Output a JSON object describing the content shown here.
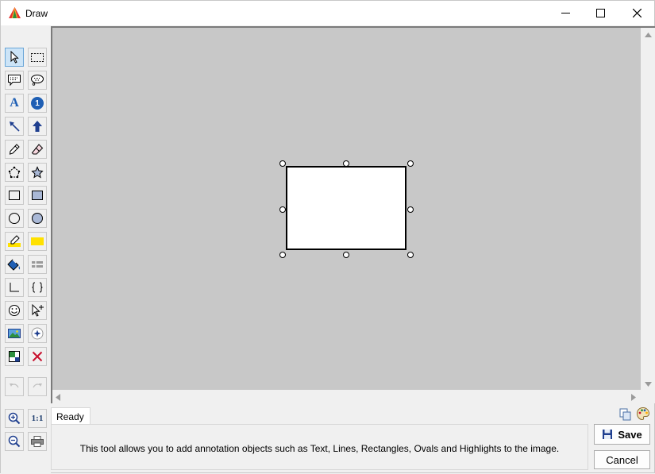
{
  "window": {
    "title": "Draw",
    "minimize_icon": "minimize-icon",
    "maximize_icon": "maximize-icon",
    "close_icon": "close-icon"
  },
  "toolbox": {
    "tools": [
      {
        "name": "select",
        "icon": "pointer-icon",
        "active": true
      },
      {
        "name": "select-area",
        "icon": "dashed-rect-icon"
      },
      {
        "name": "callout",
        "icon": "speech-bubble-icon"
      },
      {
        "name": "thought-callout",
        "icon": "thought-bubble-icon"
      },
      {
        "name": "text",
        "icon": "text-a-icon",
        "glyph": "A"
      },
      {
        "name": "numbered-marker",
        "icon": "info-number-icon",
        "glyph": "1"
      },
      {
        "name": "line-arrow",
        "icon": "diagonal-arrow-icon"
      },
      {
        "name": "block-arrow",
        "icon": "up-arrow-icon"
      },
      {
        "name": "pencil",
        "icon": "pencil-icon"
      },
      {
        "name": "eraser",
        "icon": "eraser-icon"
      },
      {
        "name": "polygon",
        "icon": "polygon-outline-icon"
      },
      {
        "name": "filled-polygon",
        "icon": "polygon-filled-icon"
      },
      {
        "name": "rectangle",
        "icon": "rectangle-outline-icon"
      },
      {
        "name": "filled-rectangle",
        "icon": "rectangle-filled-icon"
      },
      {
        "name": "oval",
        "icon": "circle-outline-icon"
      },
      {
        "name": "filled-oval",
        "icon": "circle-filled-icon"
      },
      {
        "name": "highlighter",
        "icon": "highlighter-icon"
      },
      {
        "name": "highlight-rectangle",
        "icon": "highlight-rect-icon"
      },
      {
        "name": "fill",
        "icon": "paint-bucket-icon"
      },
      {
        "name": "redact",
        "icon": "redact-icon"
      },
      {
        "name": "angle",
        "icon": "angle-icon"
      },
      {
        "name": "brackets",
        "icon": "curly-braces-icon"
      },
      {
        "name": "emoji",
        "icon": "smiley-icon"
      },
      {
        "name": "add-pointer",
        "icon": "pointer-plus-icon"
      },
      {
        "name": "insert-image",
        "icon": "image-icon"
      },
      {
        "name": "spotlight",
        "icon": "spotlight-icon"
      },
      {
        "name": "crop",
        "icon": "crop-icon"
      },
      {
        "name": "delete",
        "icon": "delete-x-icon"
      },
      {
        "name": "undo",
        "icon": "undo-icon",
        "disabled": true
      },
      {
        "name": "redo",
        "icon": "redo-icon",
        "disabled": true
      },
      {
        "name": "zoom-in",
        "icon": "zoom-in-icon"
      },
      {
        "name": "actual-size",
        "icon": "one-to-one-icon",
        "glyph": "1:1"
      },
      {
        "name": "zoom-out",
        "icon": "zoom-out-icon"
      },
      {
        "name": "print",
        "icon": "printer-icon"
      }
    ]
  },
  "status": {
    "text": "Ready"
  },
  "info": {
    "text": "This tool allows you to add annotation objects such as Text, Lines, Rectangles, Ovals and Highlights to the image."
  },
  "footer_icons": {
    "copy": "copy-icon",
    "palette": "palette-icon"
  },
  "buttons": {
    "save": "Save",
    "cancel": "Cancel"
  },
  "colors": {
    "canvas_bg": "#c8c8c8",
    "active_tool_bg": "#cce4f7",
    "accent_blue": "#1f5fb4",
    "delete_red": "#c8102e",
    "highlight_yellow": "#ffe100"
  }
}
